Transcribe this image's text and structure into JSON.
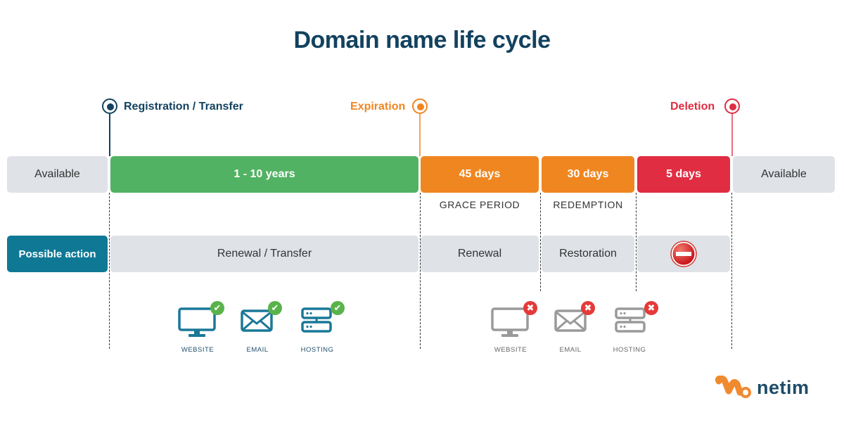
{
  "title": "Domain name life cycle",
  "colors": {
    "title": "#12425f",
    "registration": "#12425f",
    "expiration": "#f08620",
    "deletion": "#e02d42",
    "active_period": "#52b263",
    "grace_period": "#f08620",
    "redemption": "#f08620",
    "pending_delete": "#e02d42",
    "neutral": "#dfe2e7",
    "possible_action": "#0f7895",
    "icon_active": "#1a7898",
    "icon_inactive": "#9a9a9a"
  },
  "milestones": [
    {
      "label": "Registration / Transfer"
    },
    {
      "label": "Expiration"
    },
    {
      "label": "Deletion"
    }
  ],
  "timeline": [
    {
      "label": "Available"
    },
    {
      "label": "1 - 10 years"
    },
    {
      "label": "45 days",
      "sublabel": "GRACE PERIOD"
    },
    {
      "label": "30 days",
      "sublabel": "REDEMPTION"
    },
    {
      "label": "5 days"
    },
    {
      "label": "Available"
    }
  ],
  "actions": {
    "header": "Possible action",
    "items": [
      {
        "label": "Renewal / Transfer"
      },
      {
        "label": "Renewal"
      },
      {
        "label": "Restoration"
      },
      {
        "label": "",
        "icon": "no-entry-icon"
      }
    ]
  },
  "services_active": {
    "status": "check-icon",
    "items": [
      {
        "label": "WEBSITE",
        "icon": "monitor-icon"
      },
      {
        "label": "EMAIL",
        "icon": "envelope-icon"
      },
      {
        "label": "HOSTING",
        "icon": "server-icon"
      }
    ]
  },
  "services_inactive": {
    "status": "cross-icon",
    "items": [
      {
        "label": "WEBSITE",
        "icon": "monitor-icon"
      },
      {
        "label": "EMAIL",
        "icon": "envelope-icon"
      },
      {
        "label": "HOSTING",
        "icon": "server-icon"
      }
    ]
  },
  "logo": {
    "text": "netim"
  }
}
